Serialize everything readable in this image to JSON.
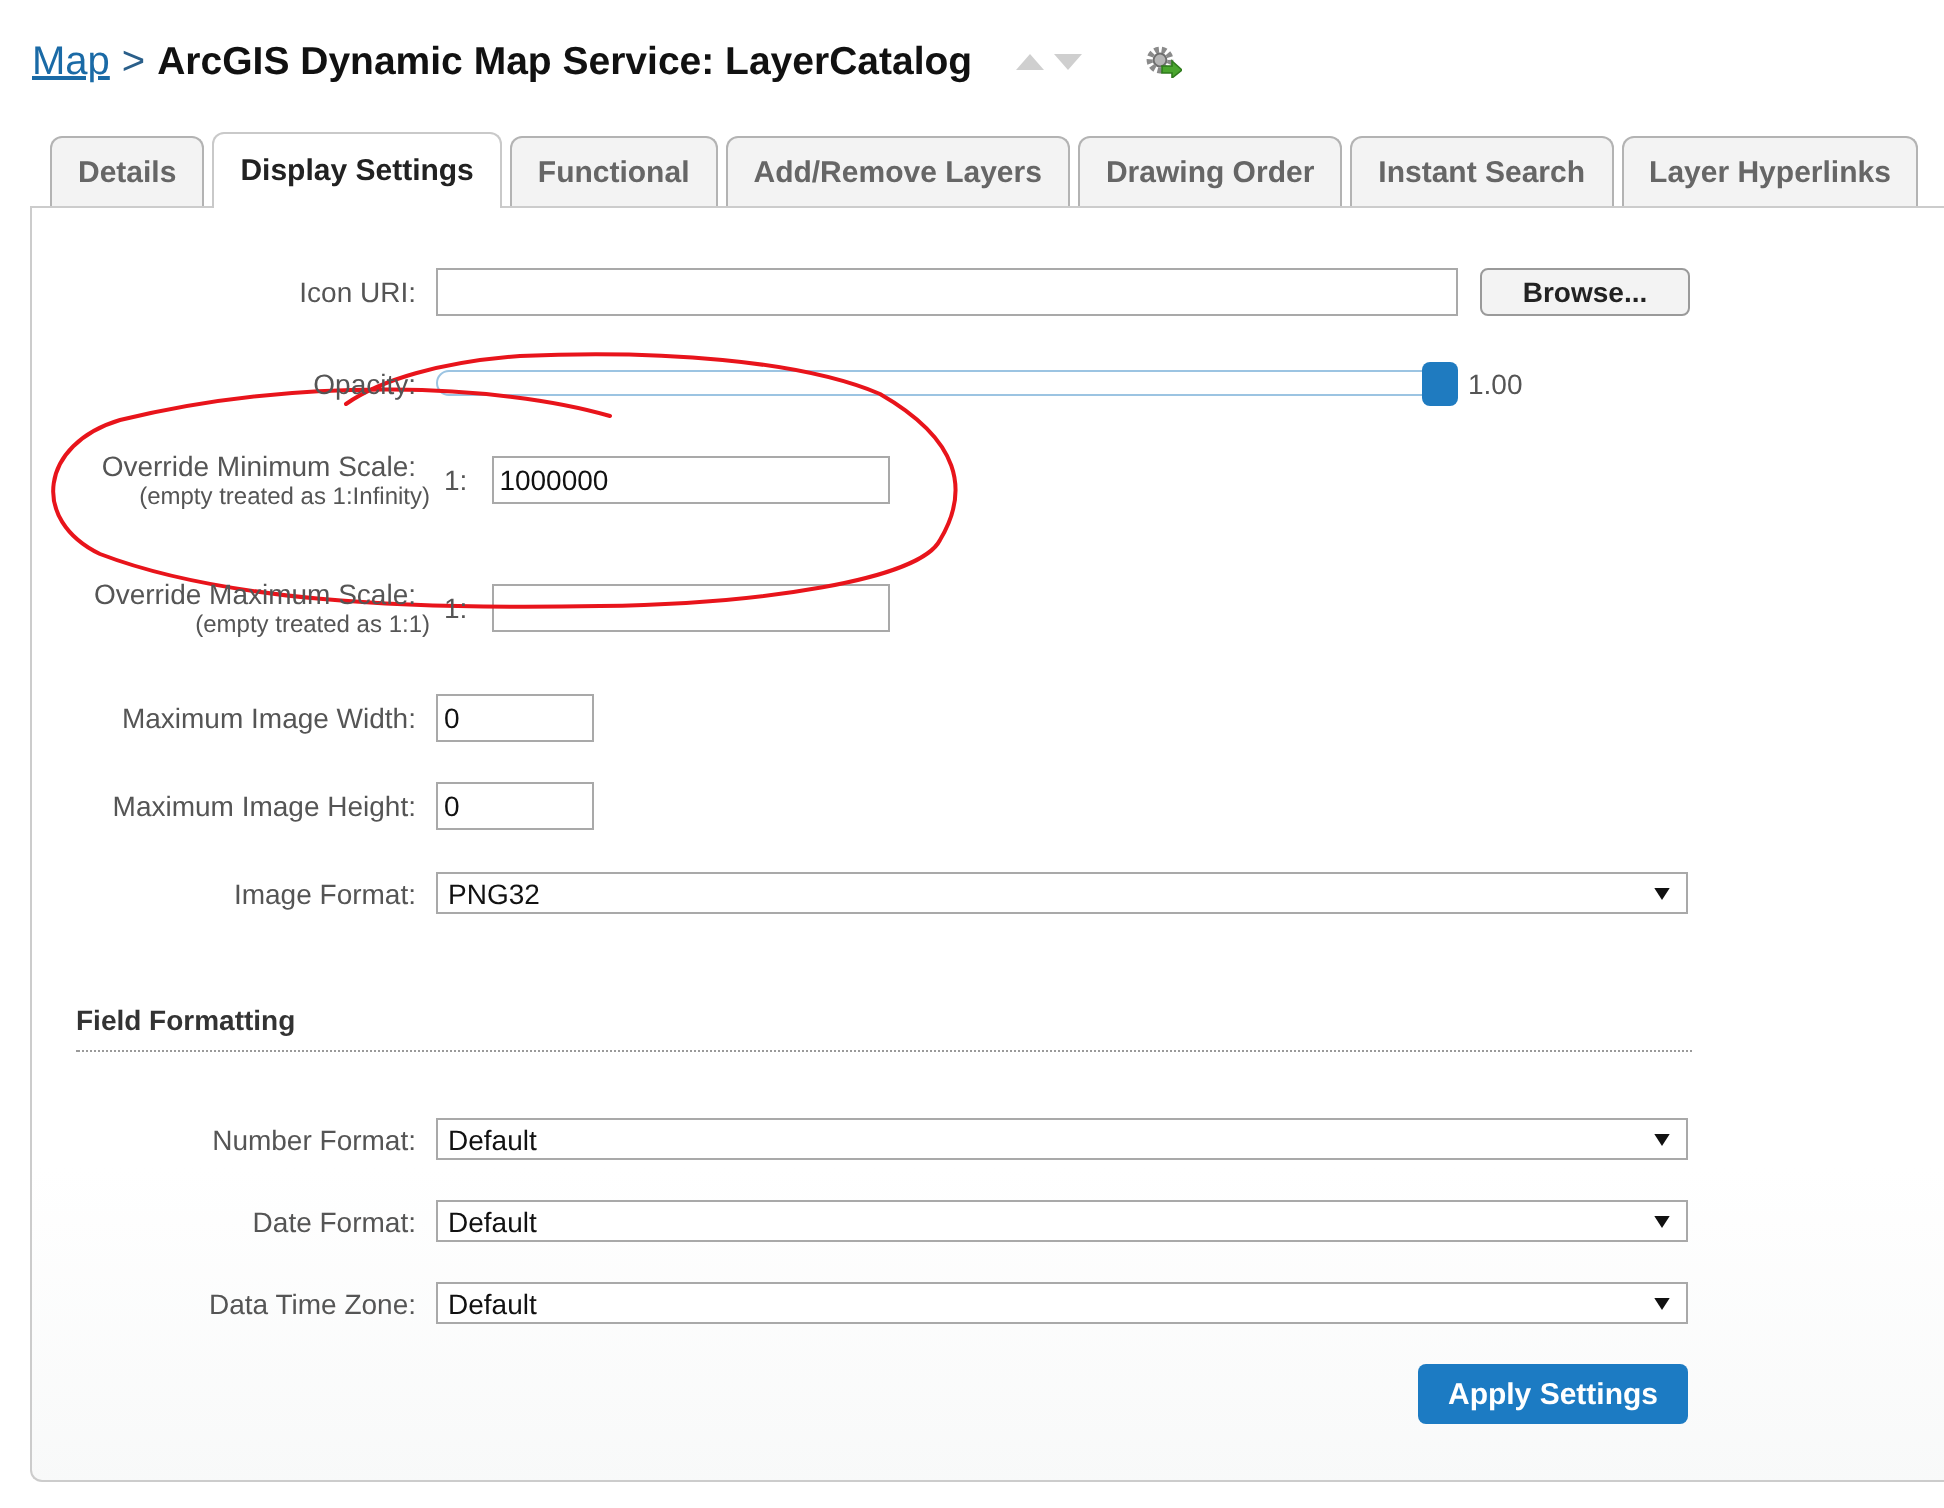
{
  "breadcrumb": {
    "link": "Map",
    "separator": ">",
    "title": "ArcGIS Dynamic Map Service: LayerCatalog"
  },
  "tabs": [
    {
      "label": "Details",
      "selected": false
    },
    {
      "label": "Display Settings",
      "selected": true
    },
    {
      "label": "Functional",
      "selected": false
    },
    {
      "label": "Add/Remove Layers",
      "selected": false
    },
    {
      "label": "Drawing Order",
      "selected": false
    },
    {
      "label": "Instant Search",
      "selected": false
    },
    {
      "label": "Layer Hyperlinks",
      "selected": false
    }
  ],
  "form": {
    "rows": [
      {
        "kind": "file",
        "label": "Icon URI:",
        "button": "Browse..."
      },
      {
        "kind": "slider",
        "label": "Opacity:",
        "level": 1,
        "reading": "1.00"
      },
      {
        "kind": "scale",
        "label": "Override Minimum Scale:",
        "note": "(empty treated as 1:Infinity)",
        "prefix": "1:",
        "value": "1000000"
      },
      {
        "kind": "scale",
        "label": "Override Maximum Scale:",
        "note": "(empty treated as 1:1)",
        "prefix": "1:"
      },
      {
        "kind": "text",
        "label": "Maximum Image Width:",
        "value": "0"
      },
      {
        "kind": "text",
        "label": "Maximum Image Height:",
        "value": "0"
      },
      {
        "kind": "select",
        "label": "Image Format:",
        "value": "PNG32"
      }
    ]
  },
  "field_formatting": {
    "heading": "Field Formatting",
    "rows": [
      {
        "kind": "select",
        "label": "Number Format:",
        "value": "Default"
      },
      {
        "kind": "select",
        "label": "Date Format:",
        "value": "Default"
      },
      {
        "kind": "select",
        "label": "Data Time Zone:",
        "value": "Default"
      }
    ]
  },
  "apply_button": "Apply Settings"
}
